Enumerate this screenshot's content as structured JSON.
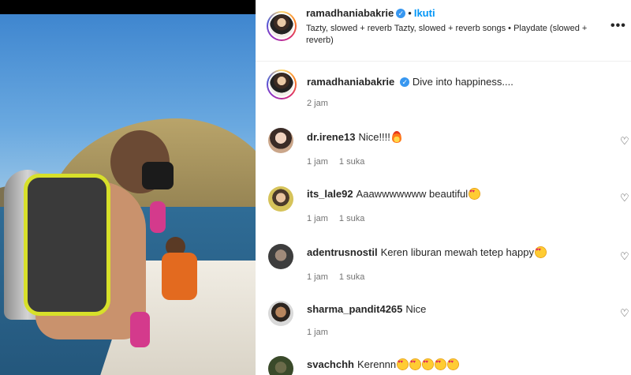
{
  "post": {
    "author": "ramadhaniabakrie",
    "follow_label": "Ikuti",
    "audio": "Tazty, slowed + reverb Tazty, slowed + reverb songs • Playdate (slowed + reverb)",
    "more_label": "•••"
  },
  "caption": {
    "username": "ramadhaniabakrie",
    "text": "Dive into happiness....",
    "time": "2 jam"
  },
  "comments": [
    {
      "username": "dr.irene13",
      "text": "Nice!!!!",
      "time": "1 jam",
      "likes": "1 suka",
      "emoji": "fire"
    },
    {
      "username": "its_lale92",
      "text": "Aaawwwwwww beautiful",
      "time": "1 jam",
      "likes": "1 suka",
      "emoji": "heart-eyes"
    },
    {
      "username": "adentrusnostil",
      "text": "Keren liburan mewah tetep happy",
      "time": "1 jam",
      "likes": "1 suka",
      "emoji": "heart-eyes"
    },
    {
      "username": "sharma_pandit4265",
      "text": "Nice",
      "time": "1 jam",
      "likes": "",
      "emoji": ""
    },
    {
      "username": "svachchh",
      "text": "Kerennn",
      "time": "",
      "likes": "",
      "emoji": "heart-eyes x5"
    }
  ],
  "colors": {
    "accent": "#0095f6",
    "verified": "#3897f0",
    "muted": "#737373"
  }
}
